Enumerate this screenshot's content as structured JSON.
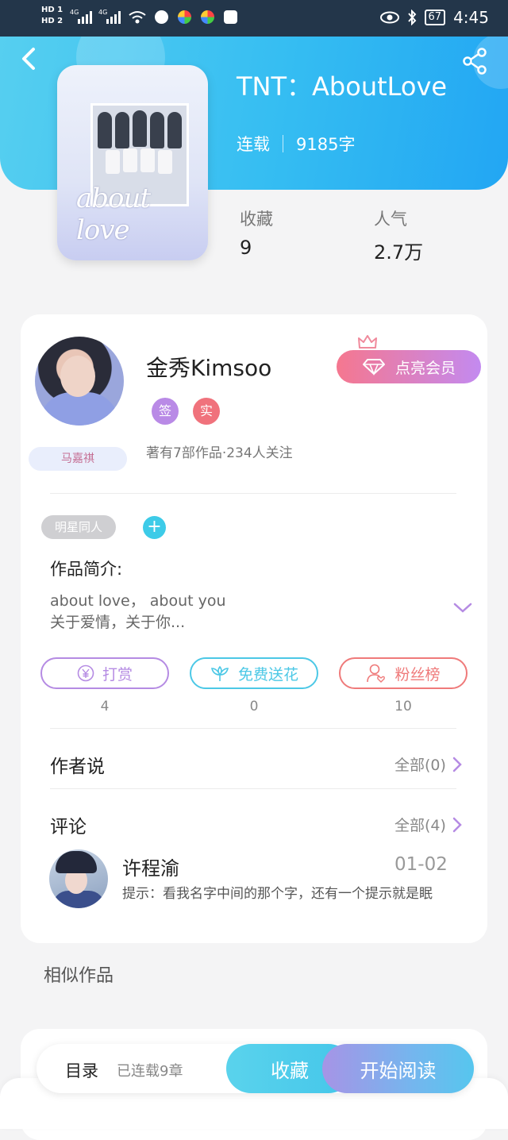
{
  "status_bar": {
    "sim_labels": [
      "HD 1",
      "HD 2"
    ],
    "net_labels": [
      "4G",
      "4G"
    ],
    "battery": "67",
    "time": "4:45"
  },
  "book": {
    "cover_text": "about love",
    "title": "TNT：AboutLove",
    "status": "连载",
    "word_count": "9185字",
    "stats": [
      {
        "label": "收藏",
        "value": "9"
      },
      {
        "label": "人气",
        "value": "2.7万"
      }
    ]
  },
  "author": {
    "name": "金秀Kimsoo",
    "nametag": "马嘉祺",
    "vip_button": "点亮会员",
    "badges": [
      {
        "text": "签",
        "color": "#b98ae6"
      },
      {
        "text": "实",
        "color": "#f0727c"
      }
    ],
    "works_info": "著有7部作品·234人关注"
  },
  "intro": {
    "tag": "明星同人",
    "add_symbol": "+",
    "label": "作品简介:",
    "lines": [
      "about love， about you",
      "关于爱情，关于你..."
    ]
  },
  "actions": [
    {
      "label": "打赏",
      "icon": "yen-coin-icon",
      "count": "4",
      "color": "#b58be3"
    },
    {
      "label": "免费送花",
      "icon": "flower-icon",
      "count": "0",
      "color": "#4cc8e6"
    },
    {
      "label": "粉丝榜",
      "icon": "fan-user-icon",
      "count": "10",
      "color": "#ef7a7a"
    }
  ],
  "author_says": {
    "label": "作者说",
    "all": "全部(0)"
  },
  "comments": {
    "label": "评论",
    "all": "全部(4)",
    "items": [
      {
        "name": "许程渝",
        "date": "01-02",
        "text": "提示：看我名字中间的那个字，还有一个提示就是眠"
      }
    ]
  },
  "similar": {
    "label": "相似作品"
  },
  "bottom": {
    "toc": "目录",
    "toc_sub": "已连载9章",
    "favorite": "收藏",
    "read": "开始阅读"
  },
  "colors": {
    "header_gradient": [
      "#56cff0",
      "#22a6f3"
    ],
    "accent_purple": "#b58be3",
    "accent_cyan": "#4cc8e6"
  }
}
